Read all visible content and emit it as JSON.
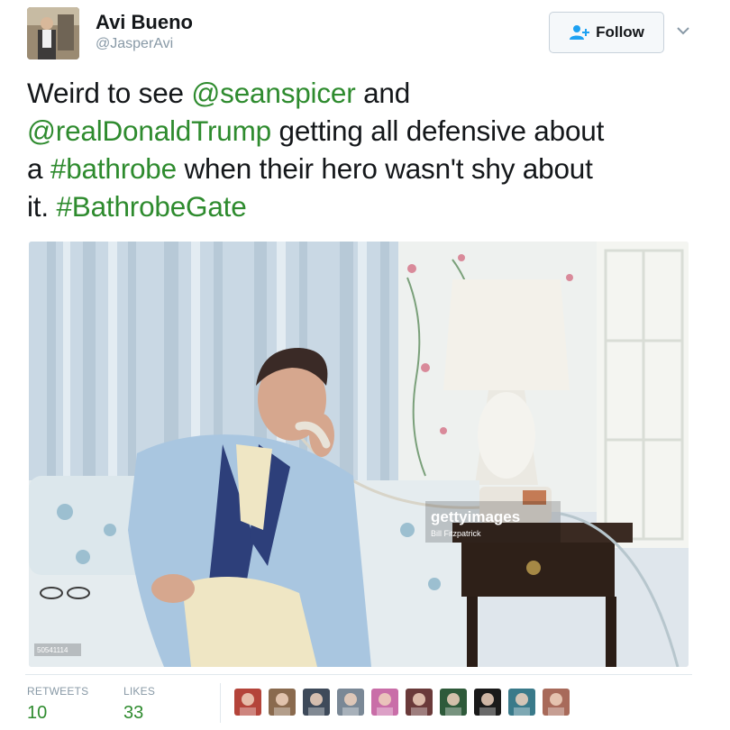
{
  "author": {
    "name": "Avi Bueno",
    "handle": "@JasperAvi"
  },
  "follow_button": {
    "label": "Follow",
    "icon": "add-user-icon"
  },
  "menu_icon": "chevron-down-icon",
  "tweet": {
    "lines": [
      [
        {
          "text": "Weird to see ",
          "link": false
        },
        {
          "text": "@seanspicer",
          "link": true
        },
        {
          "text": " and",
          "link": false
        }
      ],
      [
        {
          "text": "@realDonaldTrump",
          "link": true
        },
        {
          "text": " getting all defensive about",
          "link": false
        }
      ],
      [
        {
          "text": "a ",
          "link": false
        },
        {
          "text": "#bathrobe",
          "link": true
        },
        {
          "text": " when their hero wasn't shy about",
          "link": false
        }
      ],
      [
        {
          "text": "it. ",
          "link": false
        },
        {
          "text": "#BathrobeGate",
          "link": true
        }
      ]
    ]
  },
  "media": {
    "watermark": "gettyimages",
    "credit": "Bill Fitzpatrick",
    "image_id": "50541114"
  },
  "stats": {
    "retweets_label": "RETWEETS",
    "retweets_value": "10",
    "likes_label": "LIKES",
    "likes_value": "33"
  },
  "likers": [
    {
      "color": "#b4443a"
    },
    {
      "color": "#8a6a4e"
    },
    {
      "color": "#3e4a5a"
    },
    {
      "color": "#7a8896"
    },
    {
      "color": "#c96ea8"
    },
    {
      "color": "#6a3a3a"
    },
    {
      "color": "#2e5a3a"
    },
    {
      "color": "#1a1a1a"
    },
    {
      "color": "#3a7a8a"
    },
    {
      "color": "#a86a5a"
    }
  ],
  "colors": {
    "link": "#2e8b2e",
    "muted": "#8899a6",
    "text": "#14171a"
  }
}
